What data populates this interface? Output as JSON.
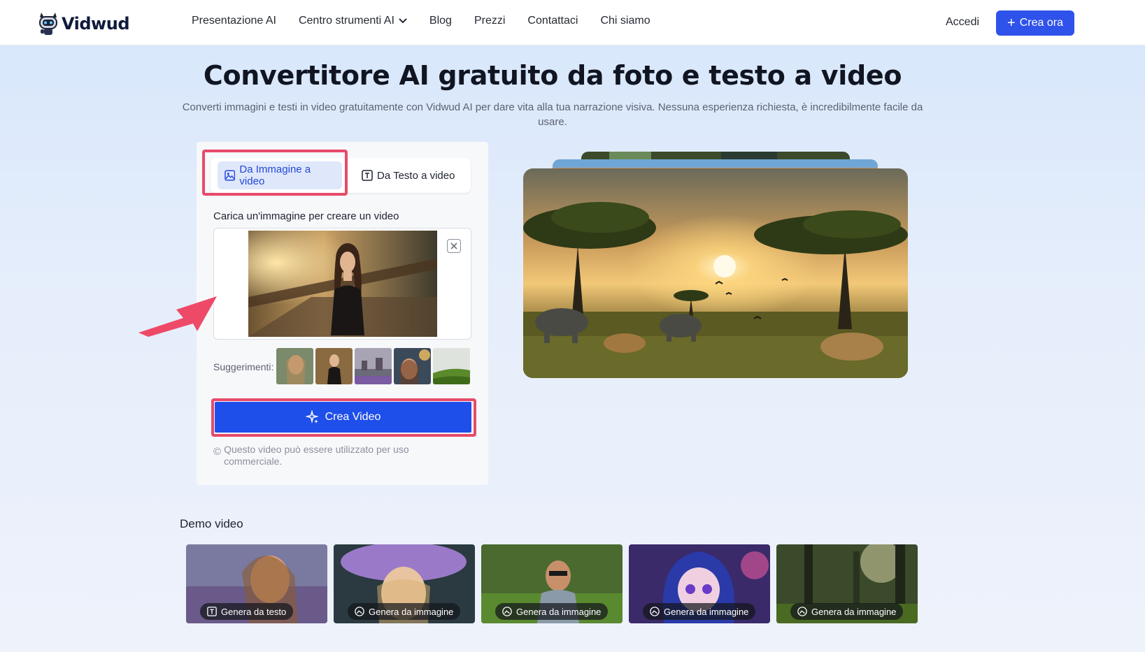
{
  "header": {
    "brand": "Vidwud",
    "nav": [
      "Presentazione AI",
      "Centro strumenti AI",
      "Blog",
      "Prezzi",
      "Contattaci",
      "Chi siamo"
    ],
    "login": "Accedi",
    "cta": "Crea ora"
  },
  "hero": {
    "title": "Convertitore AI gratuito da foto e testo a video",
    "subtitle": "Converti immagini e testi in video gratuitamente con Vidwud AI per dare vita alla tua narrazione visiva. Nessuna esperienza richiesta, è incredibilmente facile da usare."
  },
  "tool": {
    "tabs": [
      "Da Immagine a video",
      "Da Testo a video"
    ],
    "active_tab": "Da Immagine a video",
    "upload_label": "Carica un'immagine per creare un video",
    "suggestions_label": "Suggerimenti:",
    "create_button": "Crea Video",
    "note": "Questo video può essere utilizzato per uso commerciale."
  },
  "demo": {
    "title": "Demo video",
    "cards": [
      {
        "tag": "Genera da testo",
        "icon": "text-icon"
      },
      {
        "tag": "Genera da immagine",
        "icon": "image-icon"
      },
      {
        "tag": "Genera da immagine",
        "icon": "image-icon"
      },
      {
        "tag": "Genera da immagine",
        "icon": "image-icon"
      },
      {
        "tag": "Genera da immagine",
        "icon": "image-icon"
      }
    ]
  },
  "colors": {
    "accent": "#1f4fea",
    "highlight": "#e84a6a",
    "active_tab_bg": "#dfe7fb"
  }
}
